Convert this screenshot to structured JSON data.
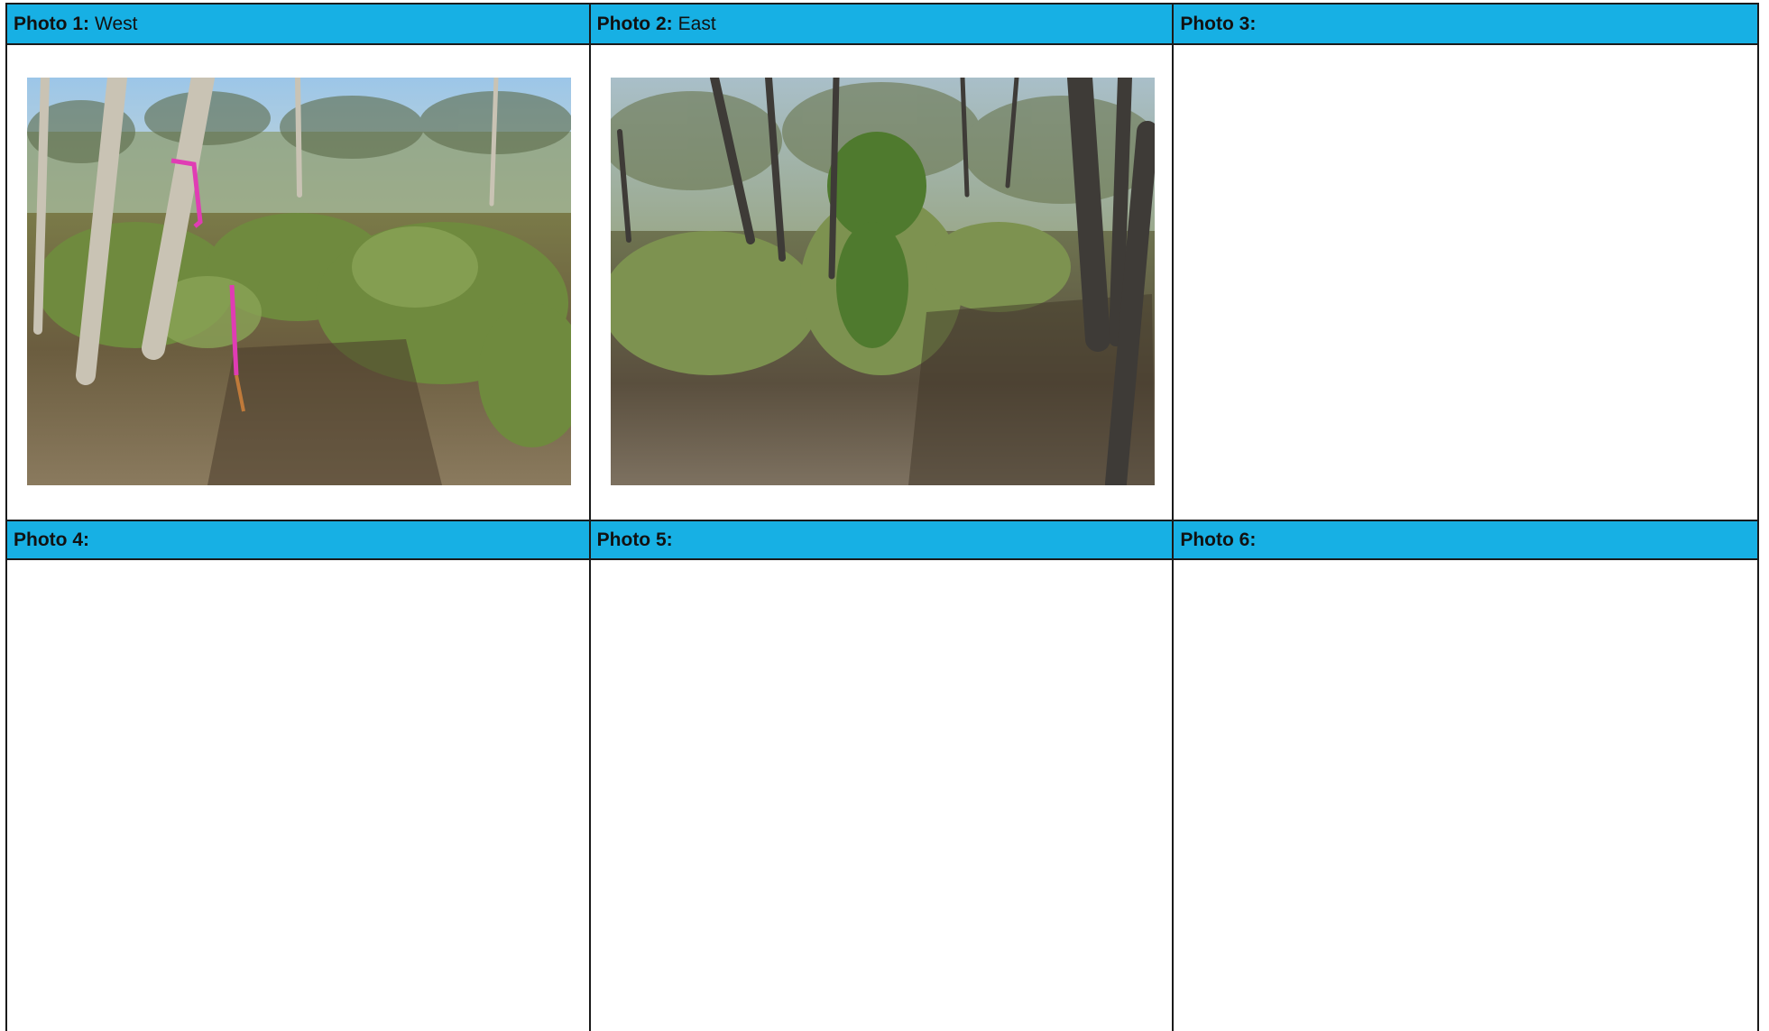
{
  "photos": [
    {
      "label": "Photo 1:",
      "direction": "West",
      "has_image": true,
      "image_description": "forest-west-image"
    },
    {
      "label": "Photo 2:",
      "direction": "East",
      "has_image": true,
      "image_description": "forest-east-image"
    },
    {
      "label": "Photo 3:",
      "direction": "",
      "has_image": false
    },
    {
      "label": "Photo 4:",
      "direction": "",
      "has_image": false
    },
    {
      "label": "Photo 5:",
      "direction": "",
      "has_image": false
    },
    {
      "label": "Photo 6:",
      "direction": "",
      "has_image": false
    }
  ],
  "colors": {
    "header_bg": "#17b0e4",
    "border": "#1a1a1a"
  }
}
